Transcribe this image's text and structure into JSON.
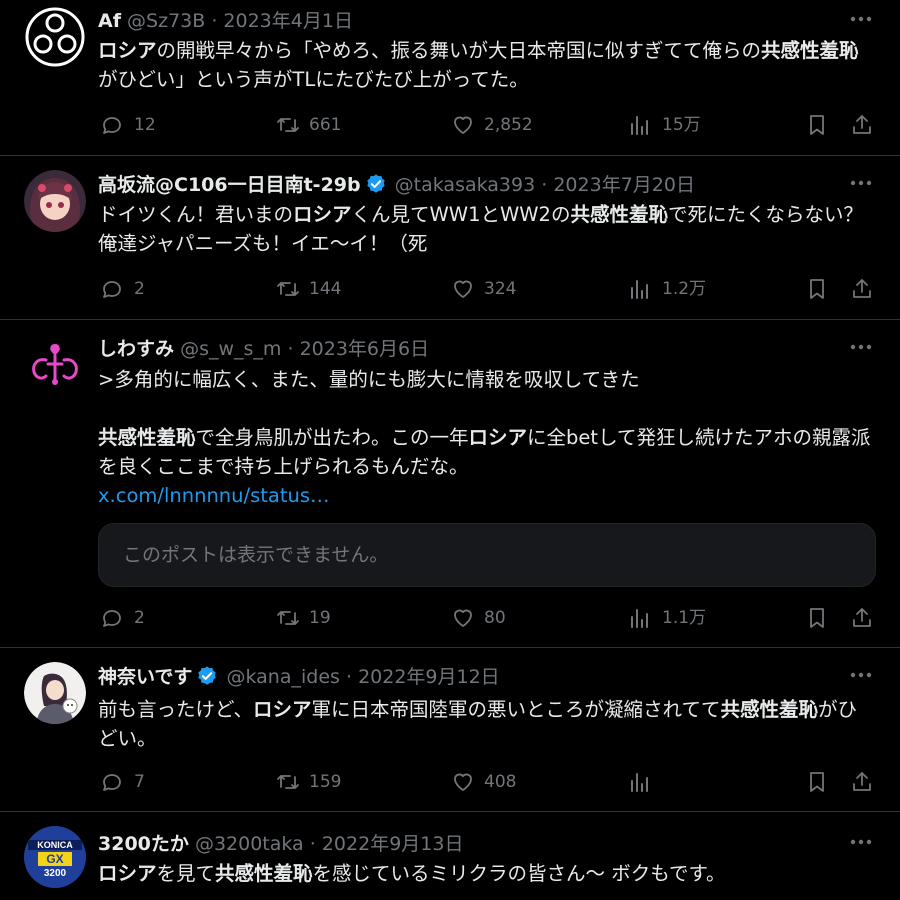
{
  "colors": {
    "background": "#000000",
    "text": "#e7e9ea",
    "muted": "#71767b",
    "link": "#1d9bf0",
    "verified": "#1d9bf0",
    "divider": "#2f3336"
  },
  "tweets": [
    {
      "name": "Af",
      "handle": "@Sz73B",
      "sep": "·",
      "date": "2023年4月1日",
      "verified": false,
      "body": [
        {
          "t": "ロシア",
          "b": true
        },
        {
          "t": "の開戦早々から「やめろ、振る舞いが大日本帝国に似すぎてて俺らの",
          "b": false
        },
        {
          "t": "共感性羞恥",
          "b": true
        },
        {
          "t": "がひどい」という声がTLにたびたび上がってた。",
          "b": false
        }
      ],
      "replies": "12",
      "reposts": "661",
      "likes": "2,852",
      "views": "15万"
    },
    {
      "name": "高坂流@C106一日目南t-29b",
      "handle": "@takasaka393",
      "sep": "·",
      "date": "2023年7月20日",
      "verified": true,
      "body": [
        {
          "t": "ドイツくん！君いまの",
          "b": false
        },
        {
          "t": "ロシア",
          "b": true
        },
        {
          "t": "くん見てWW1とWW2の",
          "b": false
        },
        {
          "t": "共感性羞恥",
          "b": true
        },
        {
          "t": "で死にたくならない？俺達ジャパニーズも！イエ〜イ！（死",
          "b": false
        }
      ],
      "replies": "2",
      "reposts": "144",
      "likes": "324",
      "views": "1.2万"
    },
    {
      "name": "しわすみ",
      "handle": "@s_w_s_m",
      "sep": "·",
      "date": "2023年6月6日",
      "verified": false,
      "quote_line": ">多角的に幅広く、また、量的にも膨大に情報を吸収してきた",
      "body": [
        {
          "t": "共感性羞恥",
          "b": true
        },
        {
          "t": "で全身鳥肌が出たわ。この一年",
          "b": false
        },
        {
          "t": "ロシア",
          "b": true
        },
        {
          "t": "に全betして発狂し続けたアホの親露派を良くここまで持ち上げられるもんだな。",
          "b": false
        }
      ],
      "link": "x.com/lnnnnnu/status…",
      "embed": "このポストは表示できません。",
      "replies": "2",
      "reposts": "19",
      "likes": "80",
      "views": "1.1万"
    },
    {
      "name": "神奈いです",
      "handle": "@kana_ides",
      "sep": "·",
      "date": "2022年9月12日",
      "verified": true,
      "body": [
        {
          "t": "前も言ったけど、",
          "b": false
        },
        {
          "t": "ロシア",
          "b": true
        },
        {
          "t": "軍に日本帝国陸軍の悪いところが凝縮されてて",
          "b": false
        },
        {
          "t": "共感性羞恥",
          "b": true
        },
        {
          "t": "がひどい。",
          "b": false
        }
      ],
      "replies": "7",
      "reposts": "159",
      "likes": "408",
      "views": ""
    },
    {
      "name": "3200たか",
      "handle": "@3200taka",
      "sep": "·",
      "date": "2022年9月13日",
      "verified": false,
      "body": [
        {
          "t": "ロシア",
          "b": true
        },
        {
          "t": "を見て",
          "b": false
        },
        {
          "t": "共感性羞恥",
          "b": true
        },
        {
          "t": "を感じているミリクラの皆さん〜 ボクもです。",
          "b": false
        }
      ],
      "avatar_text": {
        "top": "KONICA",
        "mid": "GX",
        "bot": "3200"
      }
    }
  ]
}
